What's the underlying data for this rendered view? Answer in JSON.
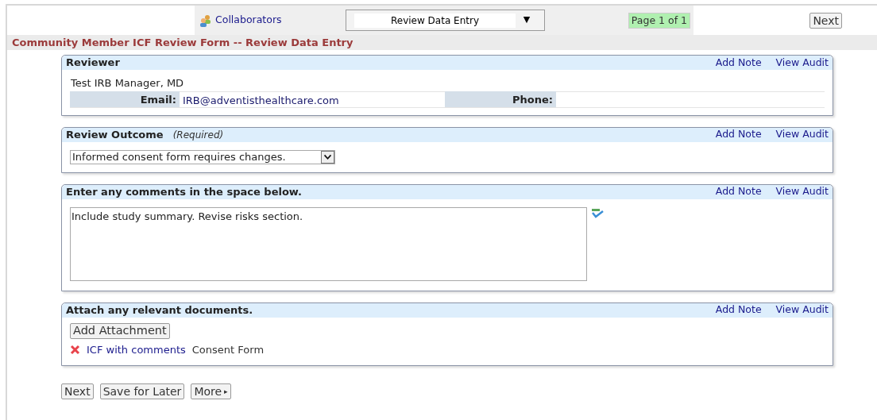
{
  "toolbar": {
    "collaborators": "Collaborators",
    "view_select": {
      "value": "Review Data Entry",
      "arrow": "▼"
    },
    "page_indicator": "Page 1 of 1",
    "next": "Next"
  },
  "form_title": "Community Member ICF Review Form -- Review Data Entry",
  "sections": [
    {
      "kind": "reviewer",
      "title": "Reviewer",
      "add_note": "Add Note",
      "view_audit": "View Audit",
      "name": "Test IRB Manager, MD",
      "email_label": "Email:",
      "email": "IRB@adventisthealthcare.com",
      "phone_label": "Phone:"
    },
    {
      "kind": "select",
      "title": "Review Outcome",
      "note": "(Required)",
      "add_note": "Add Note",
      "view_audit": "View Audit",
      "value": "Informed consent form requires changes."
    },
    {
      "kind": "textarea",
      "title": "Enter any comments in the space below.",
      "add_note": "Add Note",
      "view_audit": "View Audit",
      "value": "Include study summary. Revise risks section."
    },
    {
      "kind": "attachments",
      "title": "Attach any relevant documents.",
      "add_note": "Add Note",
      "view_audit": "View Audit",
      "button": "Add Attachment",
      "files": [
        {
          "name": "ICF with comments",
          "type": "Consent Form"
        }
      ]
    }
  ],
  "footer_buttons": [
    {
      "label": "Next"
    },
    {
      "label": "Save for Later"
    },
    {
      "label": "More",
      "arrow": "▸"
    }
  ]
}
